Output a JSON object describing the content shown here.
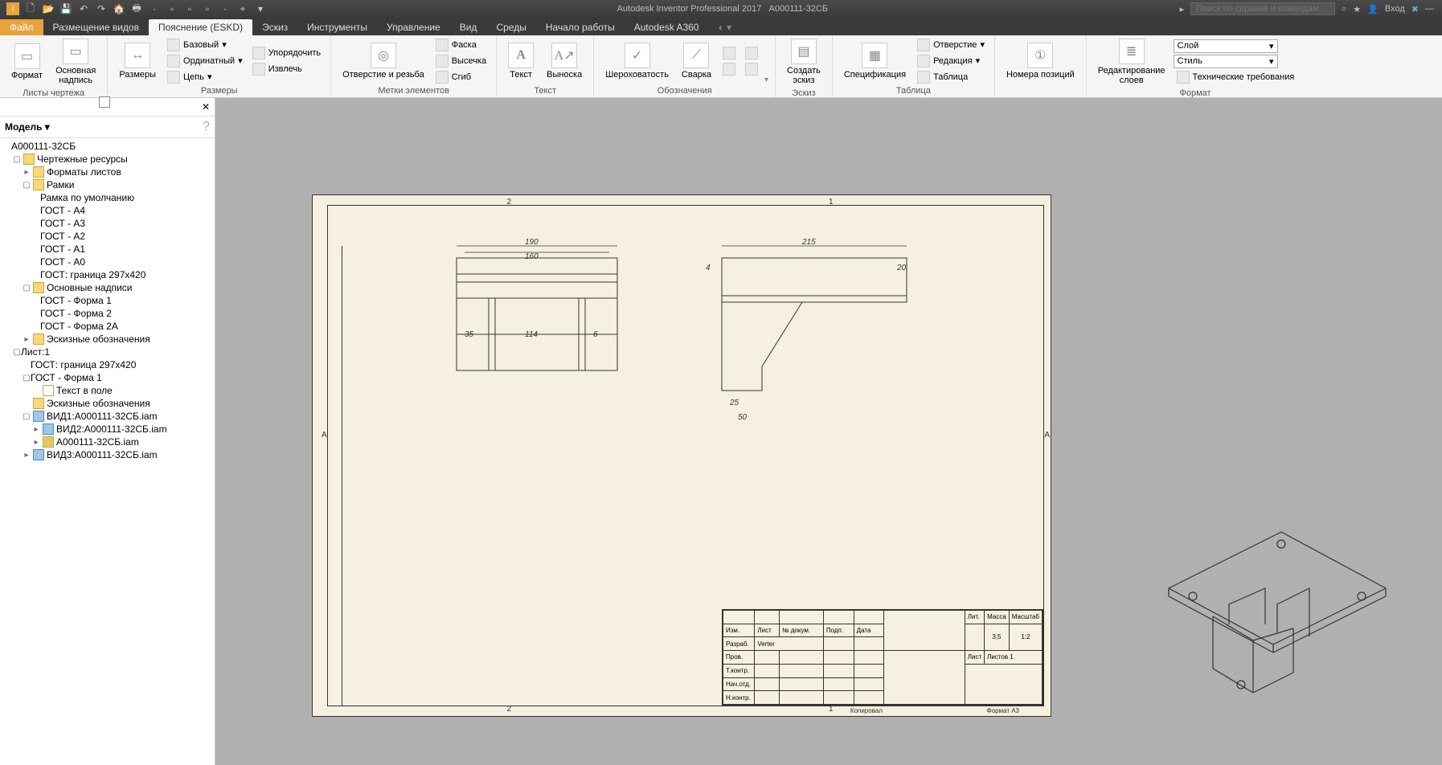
{
  "titlebar": {
    "app": "Autodesk Inventor Professional 2017",
    "doc": "А000111-32СБ",
    "search_placeholder": "Поиск по справке и командам...",
    "login": "Вход"
  },
  "tabs": {
    "file": "Файл",
    "items": [
      "Размещение видов",
      "Пояснение (ESKD)",
      "Эскиз",
      "Инструменты",
      "Управление",
      "Вид",
      "Среды",
      "Начало работы",
      "Autodesk A360"
    ],
    "active_index": 1
  },
  "ribbon": {
    "g1": {
      "label": "Листы чертежа",
      "btn1": "Формат",
      "btn2": "Основная\nнадпись"
    },
    "g2": {
      "label": "Размеры",
      "btn": "Размеры",
      "s1": "Базовый",
      "s2": "Ординатный",
      "s3": "Цепь",
      "s4": "Упорядочить",
      "s5": "Извлечь"
    },
    "g3": {
      "label": "Метки элементов",
      "btn": "Отверстие и резьба",
      "s1": "Фаска",
      "s2": "Высечка",
      "s3": "Сгиб"
    },
    "g4": {
      "label": "Текст",
      "b1": "Текст",
      "b2": "Выноска"
    },
    "g5": {
      "label": "Обозначения",
      "b1": "Шероховатость",
      "b2": "Сварка"
    },
    "g6": {
      "label": "Эскиз",
      "btn": "Создать\nэскиз"
    },
    "g7": {
      "label": "Таблица",
      "btn": "Спецификация",
      "s1": "Отверстие",
      "s2": "Редакция",
      "s3": "Таблица"
    },
    "g8": {
      "btn": "Номера позиций"
    },
    "g9": {
      "label": "Формат",
      "btn": "Редактирование\nслоев",
      "c1": "Слой",
      "c2": "Стиль",
      "s1": "Технические требования"
    }
  },
  "sidebar": {
    "title": "Модель",
    "root": "А000111-32СБ",
    "folder1": "Чертежные ресурсы",
    "folder1_1": "Форматы листов",
    "folder1_2": "Рамки",
    "frames": [
      "Рамка по умолчанию",
      "ГОСТ - А4",
      "ГОСТ - А3",
      "ГОСТ - А2",
      "ГОСТ - А1",
      "ГОСТ - А0",
      "ГОСТ: граница 297х420"
    ],
    "folder1_3": "Основные надписи",
    "titles": [
      "ГОСТ - Форма 1",
      "ГОСТ - Форма 2",
      "ГОСТ - Форма 2А"
    ],
    "folder1_4": "Эскизные обозначения",
    "sheet": "Лист:1",
    "sheet_items": [
      "ГОСТ: граница 297х420",
      "ГОСТ - Форма 1",
      "Текст в поле",
      "Эскизные обозначения"
    ],
    "views": [
      "ВИД1:А000111-32СБ.iam",
      "ВИД2:А000111-32СБ.iam",
      "А000111-32СБ.iam",
      "ВИД3:А000111-32СБ.iam"
    ]
  },
  "drawing": {
    "d1": "190",
    "d2": "160",
    "d3": "35",
    "d4": "114",
    "d5": "6",
    "d6": "215",
    "d7": "4",
    "d8": "20",
    "d9": "25",
    "d10": "50",
    "zone1": "1",
    "zone2": "2",
    "zoneA": "А",
    "title_block": {
      "row1": [
        "Изм.",
        "Лист",
        "№ докум.",
        "Подп.",
        "Дата"
      ],
      "row2_1": "Разраб.",
      "row2_2": "Verter",
      "row3": "Пров.",
      "row4": "Т.контр.",
      "row5": "Нач.отд.",
      "row6": "Н.контр.",
      "stage": "Лит.",
      "mass": "Масса",
      "scale": "Масштаб",
      "mass_val": "3,5",
      "scale_val": "1:2",
      "sheet_l": "Лист",
      "sheets_l": "Листов 1",
      "copy": "Копировал",
      "format": "Формат А3"
    }
  }
}
